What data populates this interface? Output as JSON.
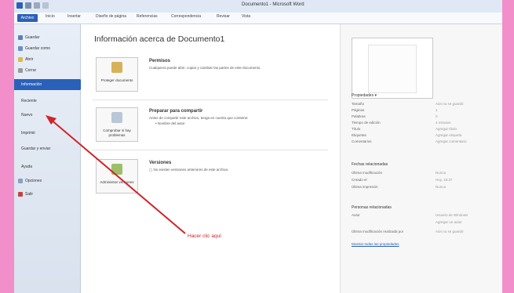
{
  "window": {
    "title": "Documento1 - Microsoft Word"
  },
  "ribbon": {
    "tabs": [
      "Archivo",
      "Inicio",
      "Insertar",
      "Diseño de página",
      "Referencias",
      "Correspondencia",
      "Revisar",
      "Vista"
    ]
  },
  "sidebar": {
    "items": [
      {
        "label": "Guardar"
      },
      {
        "label": "Guardar como"
      },
      {
        "label": "Abrir"
      },
      {
        "label": "Cerrar"
      },
      {
        "label": "Información"
      },
      {
        "label": "Reciente"
      },
      {
        "label": "Nuevo"
      },
      {
        "label": "Imprimir"
      },
      {
        "label": "Guardar y enviar"
      },
      {
        "label": "Ayuda"
      },
      {
        "label": "Opciones"
      },
      {
        "label": "Salir"
      }
    ]
  },
  "main": {
    "title": "Información acerca de Documento1",
    "sections": [
      {
        "button": "Proteger documento",
        "title": "Permisos",
        "desc": "Cualquiera puede abrir, copiar y cambiar las partes de este documento."
      },
      {
        "button": "Comprobar si hay problemas",
        "title": "Preparar para compartir",
        "desc": "Antes de compartir este archivo, tenga en cuenta que contiene:",
        "bullet": "Nombre del autor"
      },
      {
        "button": "Administrar versiones",
        "title": "Versiones",
        "desc": "No existen versiones anteriores de este archivo."
      }
    ]
  },
  "properties": {
    "heading": "Propiedades",
    "rows": [
      {
        "key": "Tamaño",
        "value": "Aún no se guardó"
      },
      {
        "key": "Páginas",
        "value": "1"
      },
      {
        "key": "Palabras",
        "value": "0"
      },
      {
        "key": "Tiempo de edición",
        "value": "4 minutos"
      },
      {
        "key": "Título",
        "value": "Agregar título"
      },
      {
        "key": "Etiquetas",
        "value": "Agregar etiqueta"
      },
      {
        "key": "Comentarios",
        "value": "Agregar comentario"
      }
    ],
    "dates_heading": "Fechas relacionadas",
    "dates": [
      {
        "key": "Última modificación",
        "value": "Nunca"
      },
      {
        "key": "Creado el",
        "value": "Hoy, 18:37"
      },
      {
        "key": "Última impresión",
        "value": "Nunca"
      }
    ],
    "people_heading": "Personas relacionadas",
    "people": [
      {
        "key": "Autor",
        "value": "Usuario de Windows"
      },
      {
        "key": "",
        "value": "Agregar un autor"
      },
      {
        "key": "Última modificación realizada por",
        "value": "Aún no se guardó"
      }
    ],
    "show_all": "Mostrar todas las propiedades"
  },
  "annotation": {
    "text": "Hacer clic aquí",
    "color": "#d0242a"
  },
  "colors": {
    "accent": "#2a61b8",
    "frame": "#f28ec9"
  }
}
